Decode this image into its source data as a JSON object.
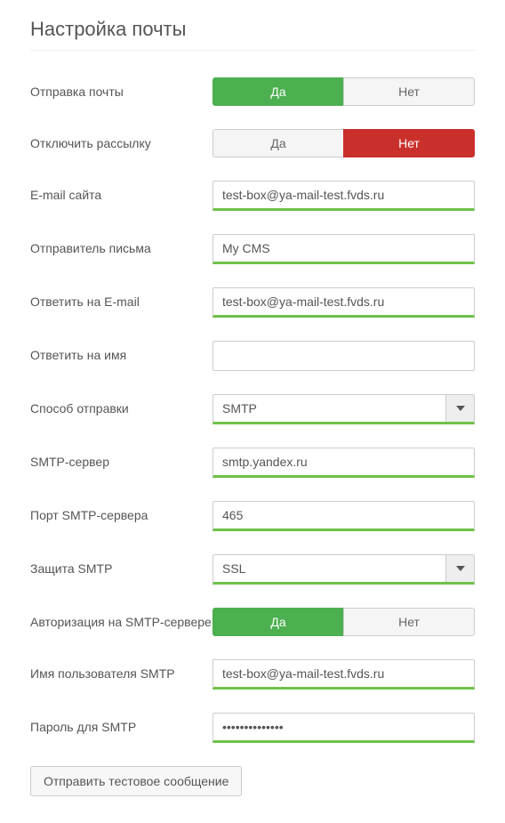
{
  "title": "Настройка почты",
  "toggle_labels": {
    "yes": "Да",
    "no": "Нет"
  },
  "fields": {
    "send_mail": {
      "label": "Отправка почты",
      "type": "toggle",
      "value": "yes",
      "accent": "green"
    },
    "disable_newsletter": {
      "label": "Отключить рассылку",
      "type": "toggle",
      "value": "no",
      "accent": "red"
    },
    "site_email": {
      "label": "E-mail сайта",
      "type": "text",
      "value": "test-box@ya-mail-test.fvds.ru"
    },
    "sender_name": {
      "label": "Отправитель письма",
      "type": "text",
      "value": "My CMS"
    },
    "reply_to_email": {
      "label": "Ответить на E-mail",
      "type": "text",
      "value": "test-box@ya-mail-test.fvds.ru"
    },
    "reply_to_name": {
      "label": "Ответить на имя",
      "type": "text",
      "value": "",
      "plain": true
    },
    "send_method": {
      "label": "Способ отправки",
      "type": "select",
      "value": "SMTP"
    },
    "smtp_server": {
      "label": "SMTP-сервер",
      "type": "text",
      "value": "smtp.yandex.ru"
    },
    "smtp_port": {
      "label": "Порт SMTP-сервера",
      "type": "text",
      "value": "465"
    },
    "smtp_security": {
      "label": "Защита SMTP",
      "type": "select",
      "value": "SSL"
    },
    "smtp_auth": {
      "label": "Авторизация на SMTP-сервере",
      "type": "toggle",
      "value": "yes",
      "accent": "green"
    },
    "smtp_user": {
      "label": "Имя пользователя SMTP",
      "type": "text",
      "value": "test-box@ya-mail-test.fvds.ru"
    },
    "smtp_pass": {
      "label": "Пароль для SMTP",
      "type": "password",
      "value": "••••••••••••••"
    }
  },
  "test_button": "Отправить тестовое сообщение"
}
